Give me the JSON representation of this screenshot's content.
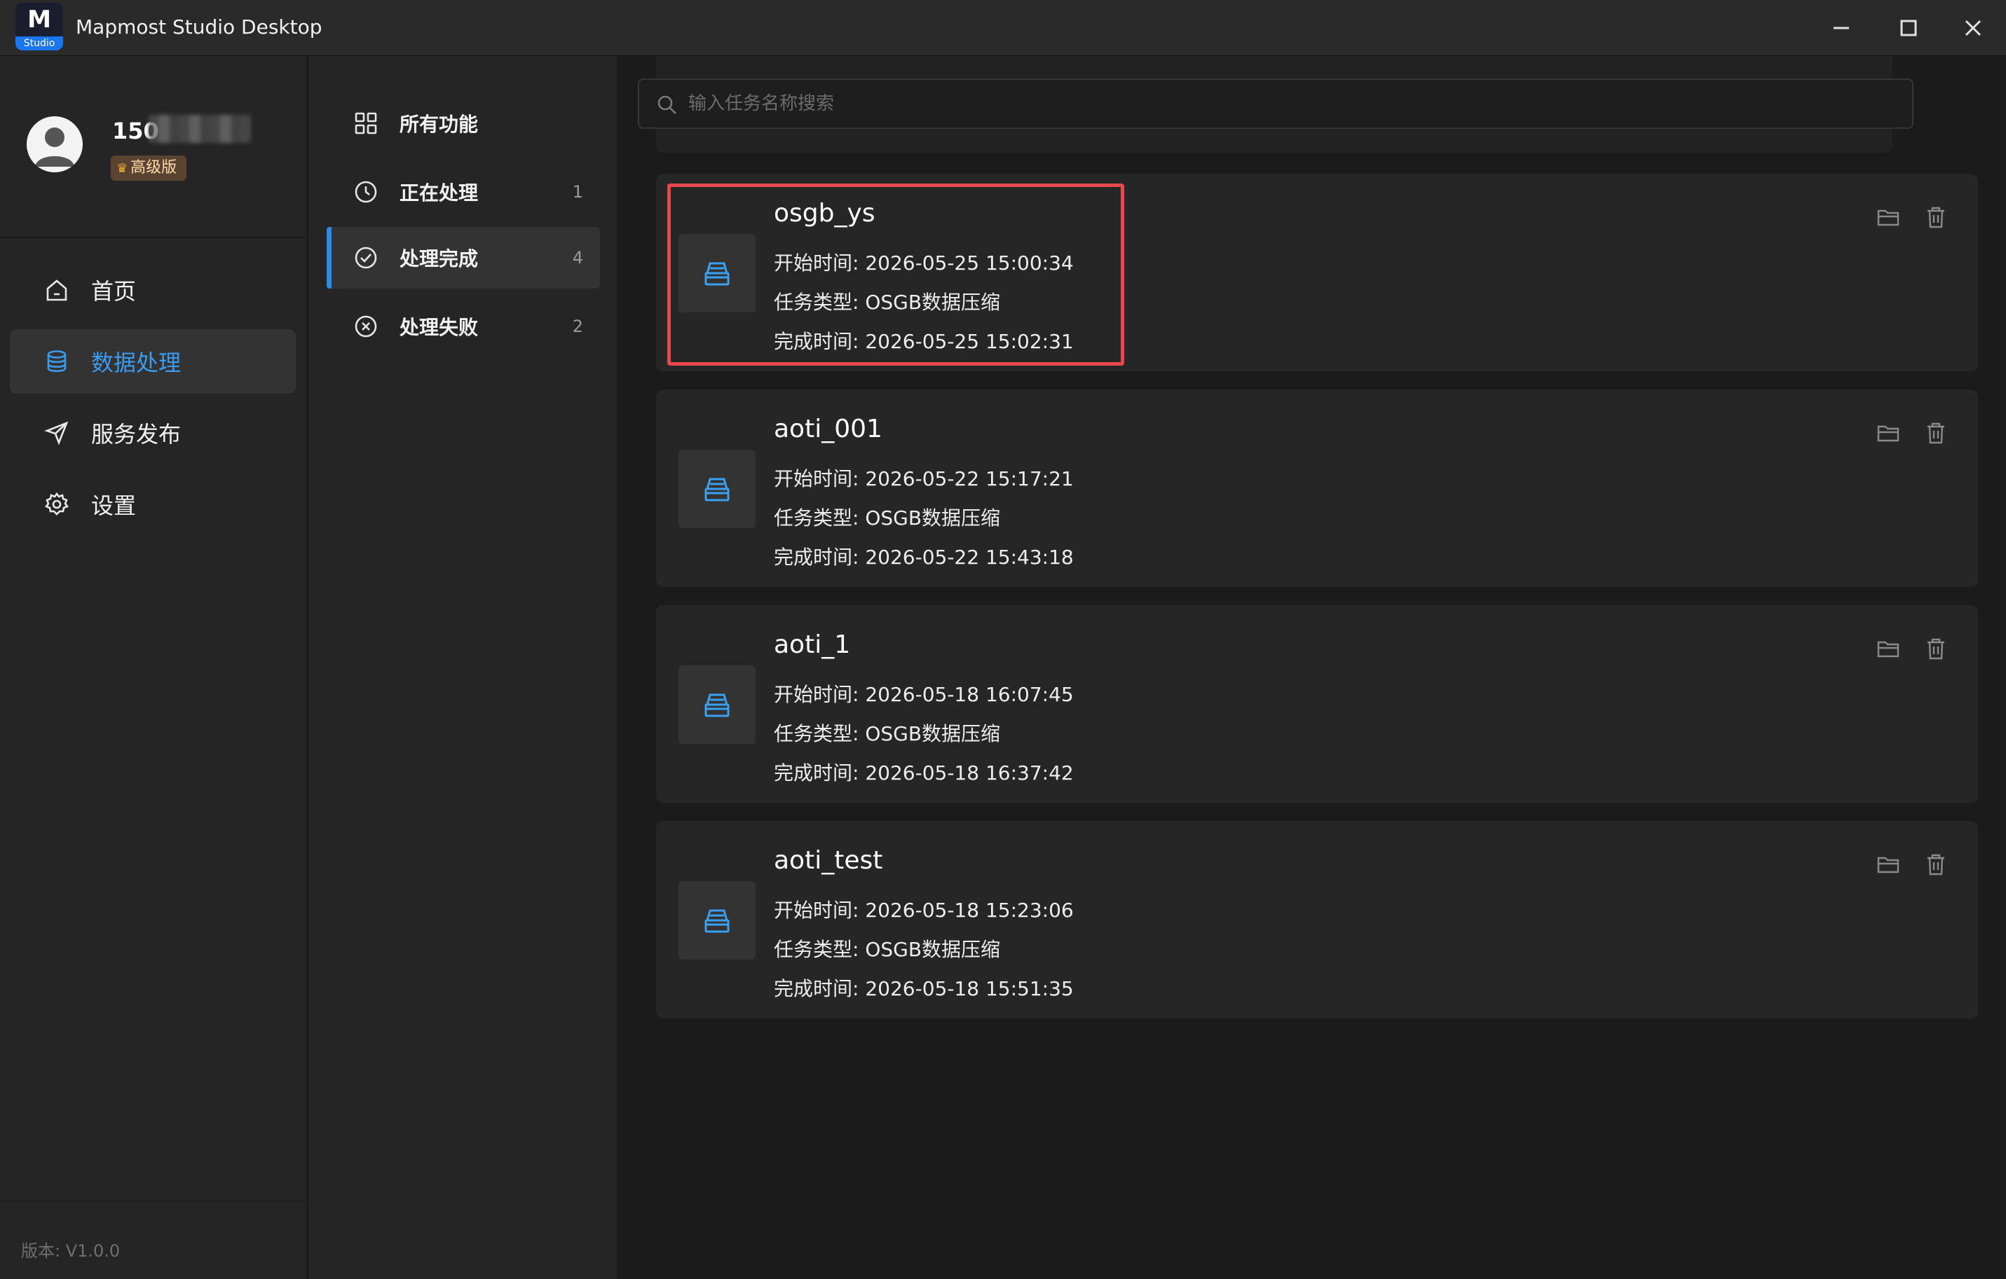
{
  "window": {
    "title": "Mapmost Studio Desktop",
    "logo_text": "Studio",
    "logo_letter": "M"
  },
  "user": {
    "name_prefix": "150",
    "badge": "高级版"
  },
  "nav": {
    "items": [
      {
        "label": "首页",
        "icon": "home-icon"
      },
      {
        "label": "数据处理",
        "icon": "database-icon",
        "active": true
      },
      {
        "label": "服务发布",
        "icon": "send-icon"
      },
      {
        "label": "设置",
        "icon": "gear-icon"
      }
    ]
  },
  "version": "版本: V1.0.0",
  "submenu": {
    "items": [
      {
        "label": "所有功能",
        "count": "",
        "icon": "grid-icon"
      },
      {
        "label": "正在处理",
        "count": "1",
        "icon": "clock-icon"
      },
      {
        "label": "处理完成",
        "count": "4",
        "icon": "check-circle-icon",
        "active": true
      },
      {
        "label": "处理失败",
        "count": "2",
        "icon": "x-circle-icon"
      }
    ]
  },
  "search": {
    "placeholder": "输入任务名称搜索",
    "value": ""
  },
  "tasks": [
    {
      "name": "osgb_ys",
      "start": "开始时间: 2026-05-25 15:00:34",
      "type": "任务类型: OSGB数据压缩",
      "end": "完成时间: 2026-05-25 15:02:31"
    },
    {
      "name": "aoti_001",
      "start": "开始时间: 2026-05-22 15:17:21",
      "type": "任务类型: OSGB数据压缩",
      "end": "完成时间: 2026-05-22 15:43:18"
    },
    {
      "name": "aoti_1",
      "start": "开始时间: 2026-05-18 16:07:45",
      "type": "任务类型: OSGB数据压缩",
      "end": "完成时间: 2026-05-18 16:37:42"
    },
    {
      "name": "aoti_test",
      "start": "开始时间: 2026-05-18 15:23:06",
      "type": "任务类型: OSGB数据压缩",
      "end": "完成时间: 2026-05-18 15:51:35"
    }
  ],
  "colors": {
    "accent": "#3a9bf0",
    "highlight": "#e8474c",
    "badge_bg": "#5a4331"
  }
}
